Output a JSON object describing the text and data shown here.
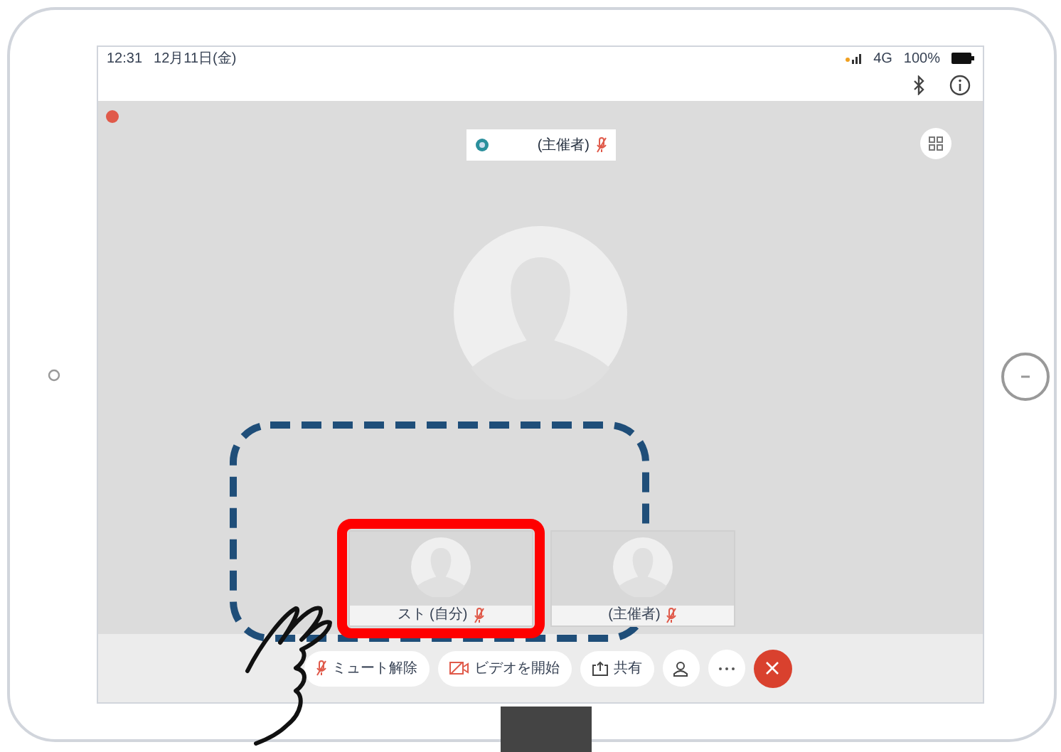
{
  "status_bar": {
    "time": "12:31",
    "date": "12月11日(金)",
    "network": "4G",
    "battery": "100%"
  },
  "speaker": {
    "label": "(主催者)",
    "muted": true
  },
  "thumbnails": [
    {
      "label": "スト (自分)",
      "muted": true,
      "selected": true
    },
    {
      "label": "(主催者)",
      "muted": true,
      "selected": false
    }
  ],
  "controls": [
    {
      "kind": "mute",
      "label": "ミュート解除"
    },
    {
      "kind": "video",
      "label": "ビデオを開始"
    },
    {
      "kind": "share",
      "label": "共有"
    },
    {
      "kind": "participants"
    },
    {
      "kind": "more"
    },
    {
      "kind": "end"
    }
  ]
}
